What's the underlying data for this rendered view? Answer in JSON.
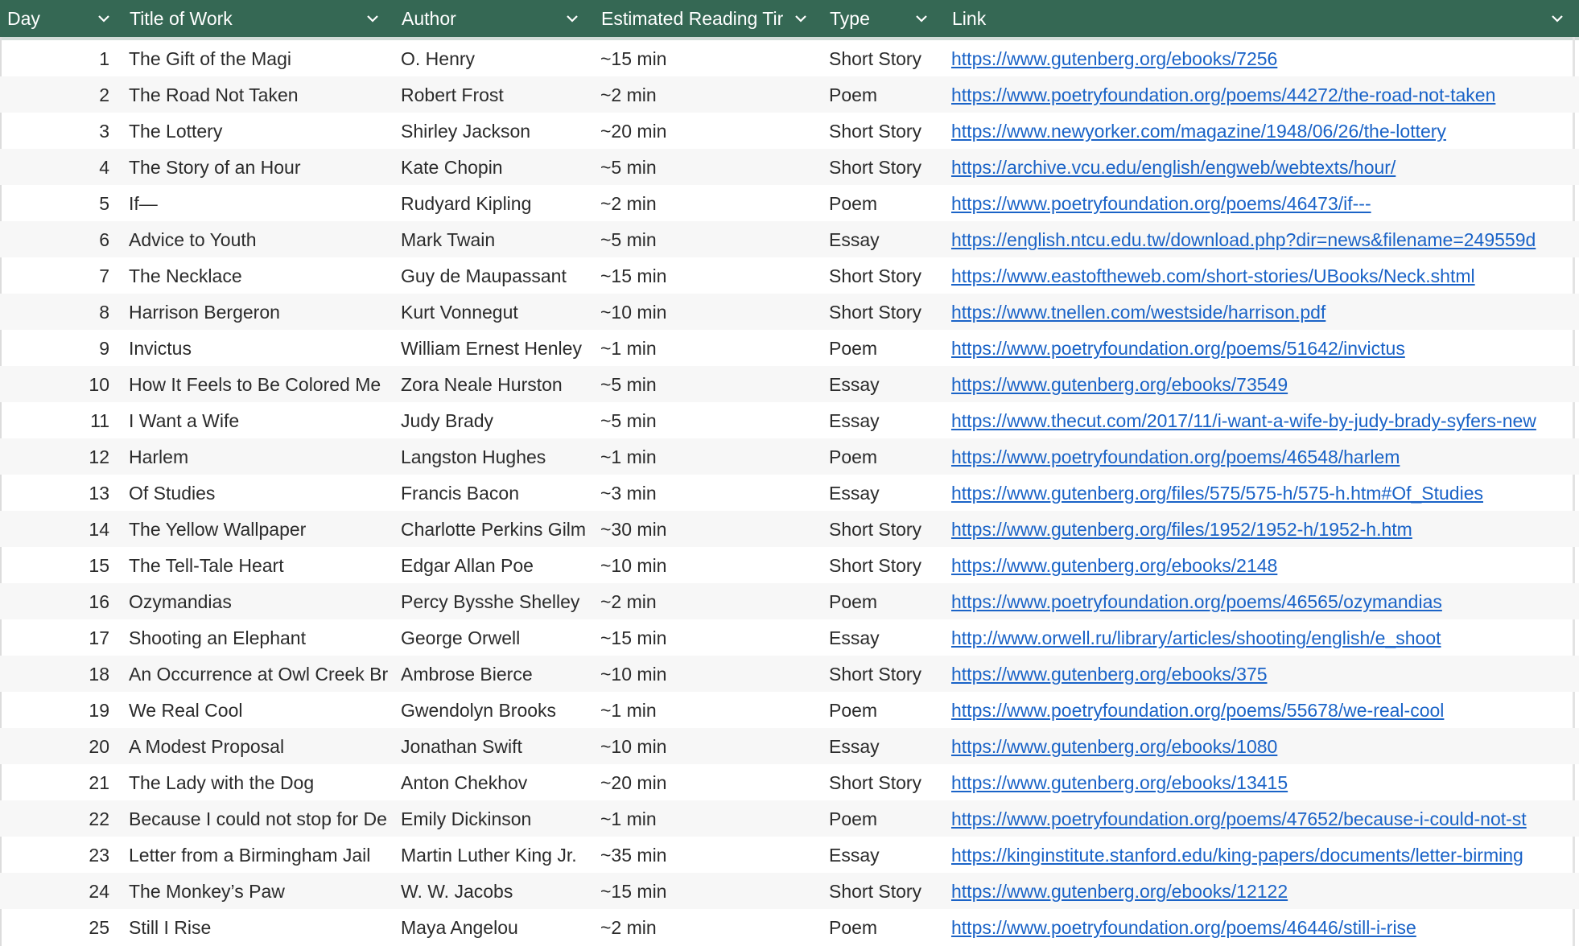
{
  "columns": {
    "day": "Day",
    "title": "Title of Work",
    "author": "Author",
    "time": "Estimated Reading Tir",
    "type": "Type",
    "link": "Link"
  },
  "rows": [
    {
      "day": "1",
      "title": "The Gift of the Magi",
      "author": "O. Henry",
      "time": "~15 min",
      "type": "Short Story",
      "link": "https://www.gutenberg.org/ebooks/7256"
    },
    {
      "day": "2",
      "title": "The Road Not Taken",
      "author": "Robert Frost",
      "time": "~2 min",
      "type": "Poem",
      "link": "https://www.poetryfoundation.org/poems/44272/the-road-not-taken"
    },
    {
      "day": "3",
      "title": "The Lottery",
      "author": "Shirley Jackson",
      "time": "~20 min",
      "type": "Short Story",
      "link": "https://www.newyorker.com/magazine/1948/06/26/the-lottery"
    },
    {
      "day": "4",
      "title": "The Story of an Hour",
      "author": "Kate Chopin",
      "time": "~5 min",
      "type": "Short Story",
      "link": "https://archive.vcu.edu/english/engweb/webtexts/hour/"
    },
    {
      "day": "5",
      "title": "If—",
      "author": "Rudyard Kipling",
      "time": "~2 min",
      "type": "Poem",
      "link": "https://www.poetryfoundation.org/poems/46473/if---"
    },
    {
      "day": "6",
      "title": "Advice to Youth",
      "author": "Mark Twain",
      "time": "~5 min",
      "type": "Essay",
      "link": "https://english.ntcu.edu.tw/download.php?dir=news&filename=249559d"
    },
    {
      "day": "7",
      "title": "The Necklace",
      "author": "Guy de Maupassant",
      "time": "~15 min",
      "type": "Short Story",
      "link": "https://www.eastoftheweb.com/short-stories/UBooks/Neck.shtml"
    },
    {
      "day": "8",
      "title": "Harrison Bergeron",
      "author": "Kurt Vonnegut",
      "time": "~10 min",
      "type": "Short Story",
      "link": "https://www.tnellen.com/westside/harrison.pdf"
    },
    {
      "day": "9",
      "title": "Invictus",
      "author": "William Ernest Henley",
      "time": "~1 min",
      "type": "Poem",
      "link": "https://www.poetryfoundation.org/poems/51642/invictus"
    },
    {
      "day": "10",
      "title": "How It Feels to Be Colored Me",
      "author": "Zora Neale Hurston",
      "time": "~5 min",
      "type": "Essay",
      "link": "https://www.gutenberg.org/ebooks/73549"
    },
    {
      "day": "11",
      "title": "I Want a Wife",
      "author": "Judy Brady",
      "time": "~5 min",
      "type": "Essay",
      "link": "https://www.thecut.com/2017/11/i-want-a-wife-by-judy-brady-syfers-new"
    },
    {
      "day": "12",
      "title": "Harlem",
      "author": "Langston Hughes",
      "time": "~1 min",
      "type": "Poem",
      "link": "https://www.poetryfoundation.org/poems/46548/harlem"
    },
    {
      "day": "13",
      "title": "Of Studies",
      "author": "Francis Bacon",
      "time": "~3 min",
      "type": "Essay",
      "link": "https://www.gutenberg.org/files/575/575-h/575-h.htm#Of_Studies"
    },
    {
      "day": "14",
      "title": "The Yellow Wallpaper",
      "author": "Charlotte Perkins Gilm",
      "time": "~30 min",
      "type": "Short Story",
      "link": "https://www.gutenberg.org/files/1952/1952-h/1952-h.htm"
    },
    {
      "day": "15",
      "title": "The Tell-Tale Heart",
      "author": "Edgar Allan Poe",
      "time": "~10 min",
      "type": "Short Story",
      "link": "https://www.gutenberg.org/ebooks/2148"
    },
    {
      "day": "16",
      "title": "Ozymandias",
      "author": "Percy Bysshe Shelley",
      "time": "~2 min",
      "type": "Poem",
      "link": "https://www.poetryfoundation.org/poems/46565/ozymandias"
    },
    {
      "day": "17",
      "title": "Shooting an Elephant",
      "author": "George Orwell",
      "time": "~15 min",
      "type": "Essay",
      "link": "http://www.orwell.ru/library/articles/shooting/english/e_shoot"
    },
    {
      "day": "18",
      "title": "An Occurrence at Owl Creek Br",
      "author": "Ambrose Bierce",
      "time": "~10 min",
      "type": "Short Story",
      "link": "https://www.gutenberg.org/ebooks/375"
    },
    {
      "day": "19",
      "title": "We Real Cool",
      "author": "Gwendolyn Brooks",
      "time": "~1 min",
      "type": "Poem",
      "link": "https://www.poetryfoundation.org/poems/55678/we-real-cool"
    },
    {
      "day": "20",
      "title": "A Modest Proposal",
      "author": "Jonathan Swift",
      "time": "~10 min",
      "type": "Essay",
      "link": "https://www.gutenberg.org/ebooks/1080"
    },
    {
      "day": "21",
      "title": "The Lady with the Dog",
      "author": "Anton Chekhov",
      "time": "~20 min",
      "type": "Short Story",
      "link": "https://www.gutenberg.org/ebooks/13415"
    },
    {
      "day": "22",
      "title": "Because I could not stop for De",
      "author": "Emily Dickinson",
      "time": "~1 min",
      "type": "Poem",
      "link": "https://www.poetryfoundation.org/poems/47652/because-i-could-not-st"
    },
    {
      "day": "23",
      "title": "Letter from a Birmingham Jail",
      "author": "Martin Luther King Jr.",
      "time": "~35 min",
      "type": "Essay",
      "link": "https://kinginstitute.stanford.edu/king-papers/documents/letter-birming"
    },
    {
      "day": "24",
      "title": "The Monkey’s Paw",
      "author": "W. W. Jacobs",
      "time": "~15 min",
      "type": "Short Story",
      "link": "https://www.gutenberg.org/ebooks/12122"
    },
    {
      "day": "25",
      "title": "Still I Rise",
      "author": "Maya Angelou",
      "time": "~2 min",
      "type": "Poem",
      "link": "https://www.poetryfoundation.org/poems/46446/still-i-rise"
    }
  ],
  "icons": {
    "column_menu": "chevron-down-icon"
  },
  "colors": {
    "header_bg": "#356854",
    "header_text": "#ffffff",
    "link": "#1a63c7",
    "row_alt": "#f7f7f7"
  }
}
